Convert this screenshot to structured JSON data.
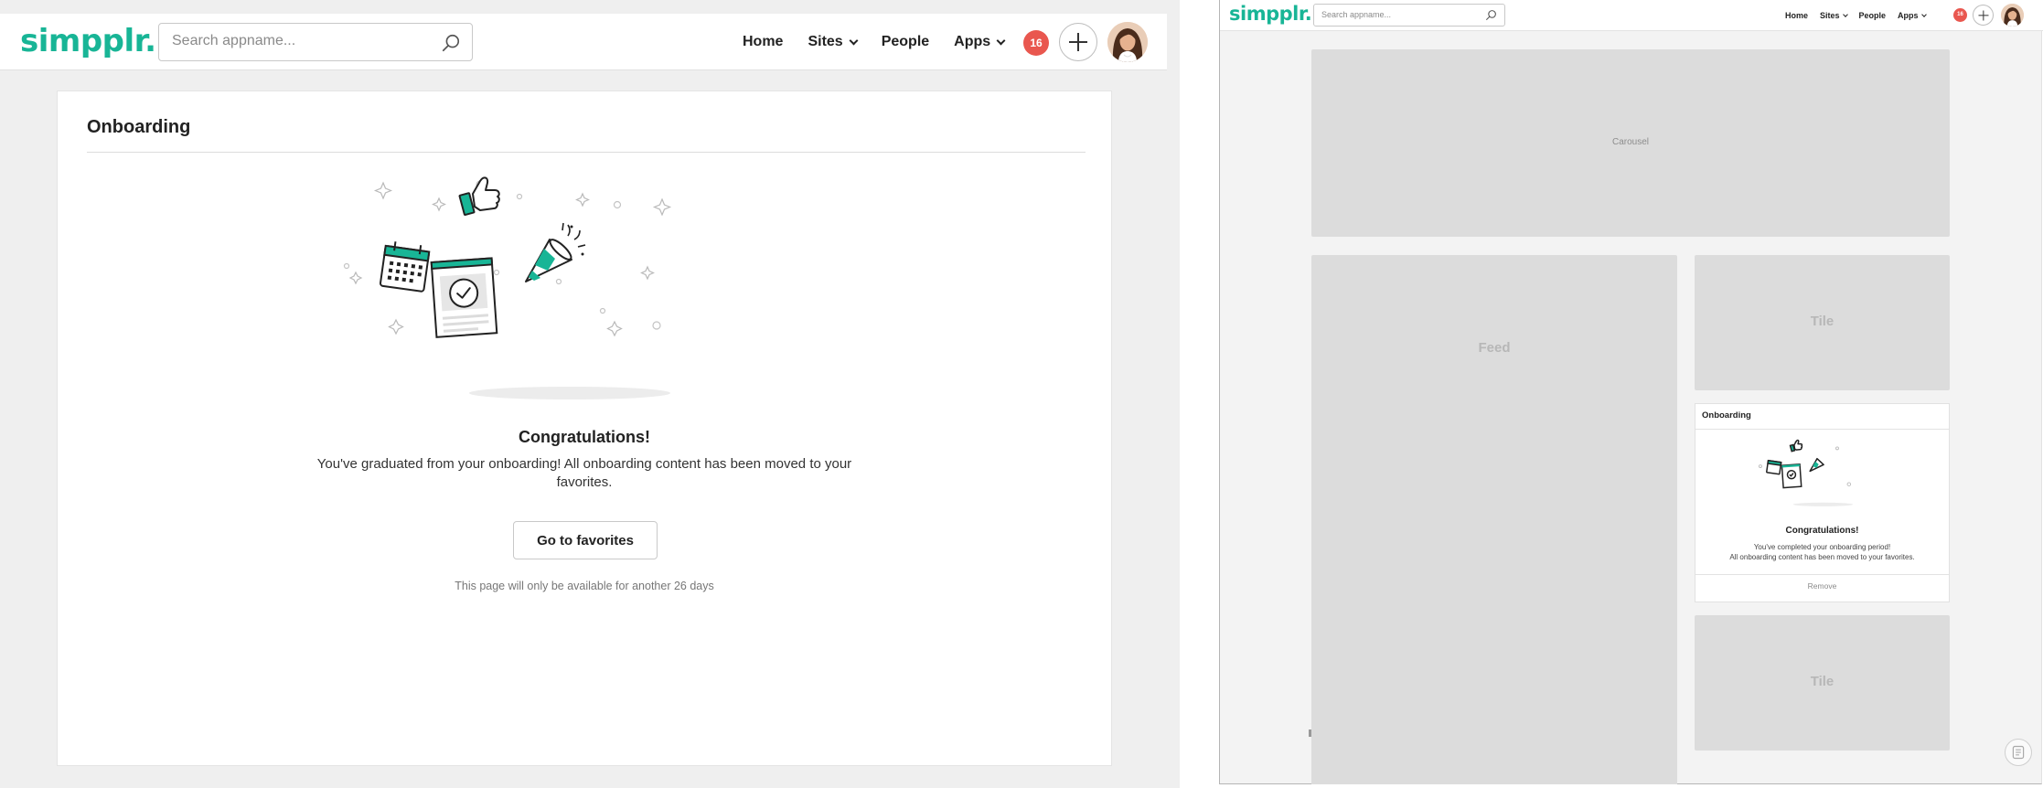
{
  "brand": {
    "logo_text": "simpplr.",
    "accent_color": "#18b596",
    "badge_color": "#e9574f"
  },
  "header": {
    "search_placeholder": "Search appname...",
    "nav": [
      {
        "label": "Home",
        "has_dropdown": false
      },
      {
        "label": "Sites",
        "has_dropdown": true
      },
      {
        "label": "People",
        "has_dropdown": false
      },
      {
        "label": "Apps",
        "has_dropdown": true
      }
    ],
    "notification_count": "16",
    "icons": [
      "search-icon",
      "plus-icon",
      "avatar"
    ]
  },
  "onboarding_page": {
    "title": "Onboarding",
    "heading": "Congratulations!",
    "message_lines": [
      "You've graduated from your onboarding! All onboarding content has been moved to your",
      "favorites."
    ],
    "button_label": "Go to favorites",
    "note": "This page will only be available for another 26 days"
  },
  "dashboard": {
    "carousel_label": "Carousel",
    "feed_label": "Feed",
    "tile_labels": [
      "Tile",
      "Tile"
    ],
    "onboarding_tile": {
      "title": "Onboarding",
      "heading": "Congratulations!",
      "message_lines": [
        "You've completed your onboarding period!",
        "All onboarding content has been moved to your favorites."
      ],
      "action_label": "Remove"
    }
  }
}
